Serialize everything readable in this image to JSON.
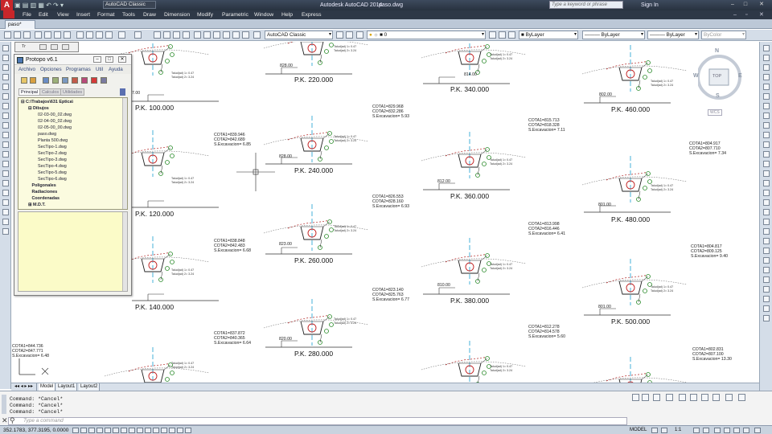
{
  "app": {
    "title": "Autodesk AutoCAD 2014",
    "file": "paso.dwg",
    "workspace": "AutoCAD Classic",
    "search_placeholder": "Type a keyword or phrase",
    "sign_in": "Sign In"
  },
  "menu": [
    "File",
    "Edit",
    "View",
    "Insert",
    "Format",
    "Tools",
    "Draw",
    "Dimension",
    "Modify",
    "Parametric",
    "Window",
    "Help",
    "Express"
  ],
  "tabs": [
    {
      "label": "paso*"
    }
  ],
  "toolbar": {
    "workspace_combo": "AutoCAD Classic",
    "layer_combo": "0",
    "color_combo": "ByLayer",
    "linetype_combo": "ByLayer",
    "lineweight_combo": "ByLayer",
    "plotstyle_combo": "ByColor"
  },
  "palette": {
    "title": "Protopo v6.1",
    "mini_title": "Tr",
    "menu": [
      "Archivo",
      "Opciones",
      "Programas",
      "Util",
      "Ayuda"
    ],
    "tabs": [
      "Principal",
      "Calculos",
      "Utilidades"
    ],
    "tree": {
      "root": "C:\\Trabajos\\631 Eptica\\",
      "dibujos": "Dibujos",
      "files": [
        "02-03-00_02.dwg",
        "02-04-00_02.dwg",
        "02-05-00_00.dwg",
        "paso.dwg",
        "Planta 500.dwg",
        "SecTipo-1.dwg",
        "SecTipo-2.dwg",
        "SecTipo-3.dwg",
        "SecTipo-4.dwg",
        "SecTipo-5.dwg",
        "SecTipo-6.dwg"
      ],
      "folders": [
        "Poligonales",
        "Radiaciones",
        "Coordenadas",
        "M.D.T."
      ]
    }
  },
  "drawing": {
    "pk_labels": [
      "P.K. 100.000",
      "P.K. 120.000",
      "P.K. 140.000",
      "P.K. 220.000",
      "P.K. 240.000",
      "P.K. 260.000",
      "P.K. 280.000",
      "P.K. 340.000",
      "P.K. 360.000",
      "P.K. 380.000",
      "P.K. 460.000",
      "P.K. 480.000",
      "P.K. 500.000"
    ],
    "elevations": [
      "828.00",
      "823.00",
      "820.00",
      "814.00",
      "812.00",
      "810.00",
      "802.00",
      "801.00",
      "801.00",
      "827.00",
      "7.00"
    ],
    "cotas": [
      {
        "c1": "COTA1=839.946",
        "c2": "COTA2=842.689",
        "s": "S.Excavacion= 6.85"
      },
      {
        "c1": "COTA1=838.848",
        "c2": "COTA2=842.483",
        "s": "S.Excavacion= 6.68"
      },
      {
        "c1": "COTA1=837.872",
        "c2": "COTA2=840.365",
        "s": "S.Excavacion= 6.64"
      },
      {
        "c1": "COTA1=829.968",
        "c2": "COTA2=832.286",
        "s": "S.Excavacion= 5.93"
      },
      {
        "c1": "COTA1=826.553",
        "c2": "COTA2=828.160",
        "s": "S.Excavacion= 6.93"
      },
      {
        "c1": "COTA1=823.140",
        "c2": "COTA2=825.763",
        "s": "S.Excavacion= 6.77"
      },
      {
        "c1": "COTA1=815.713",
        "c2": "COTA2=818.328",
        "s": "S.Excavacion= 7.11"
      },
      {
        "c1": "COTA1=813.998",
        "c2": "COTA2=816.446",
        "s": "S.Excavacion= 6.41"
      },
      {
        "c1": "COTA1=812.278",
        "c2": "COTA2=814.578",
        "s": "S.Excavacion= 5.60"
      },
      {
        "c1": "COTA1=804.917",
        "c2": "COTA2=807.710",
        "s": "S.Excavacion= 7.34"
      },
      {
        "c1": "COTA1=804.817",
        "c2": "COTA2=809.125",
        "s": "S.Excavacion= 9.40"
      },
      {
        "c1": "COTA1=802.831",
        "c2": "COTA2=807.100",
        "s": "S.Excavacion= 13.30"
      },
      {
        "c1": "COTA1=844.736",
        "c2": "COTA2=847.771",
        "s": "S.Excavacion= 6.48"
      }
    ],
    "talud_label_1": "Talud(ad) 1= 0.47",
    "talud_label_2": "Talud(ad) 2= 3.24",
    "navcube": {
      "n": "N",
      "s": "S",
      "e": "E",
      "w": "W",
      "top": "TOP",
      "wcs": "WCS"
    }
  },
  "layout_tabs": [
    "Model",
    "Layout1",
    "Layout2"
  ],
  "command": {
    "history": [
      "Command: *Cancel*",
      "Command: *Cancel*",
      "Command: *Cancel*"
    ],
    "placeholder": "Type a command"
  },
  "status": {
    "coords": "352.1783, 377.3195, 0.0000",
    "model": "MODEL",
    "scale": "1:1"
  }
}
